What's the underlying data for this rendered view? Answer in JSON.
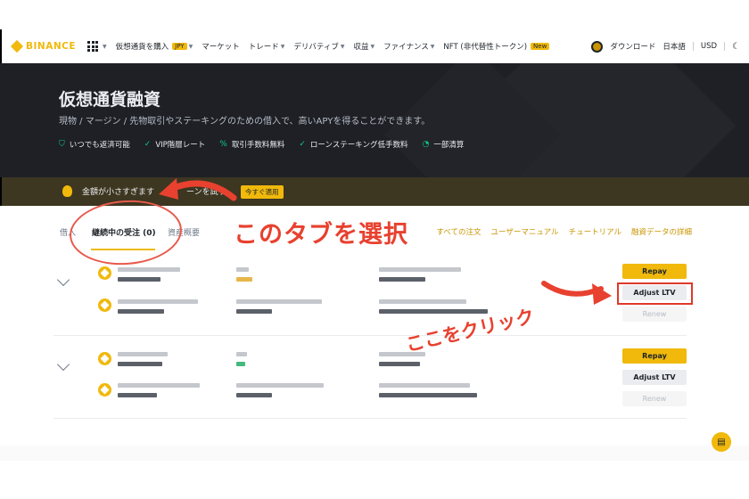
{
  "nav": {
    "logo": "BINANCE",
    "menu": [
      {
        "label": "仮想通貨を購入",
        "tag": "JPY"
      },
      {
        "label": "マーケット",
        "tag": ""
      },
      {
        "label": "トレード",
        "tag": ""
      },
      {
        "label": "デリバティブ",
        "tag": ""
      },
      {
        "label": "収益",
        "tag": ""
      },
      {
        "label": "ファイナンス",
        "tag": ""
      },
      {
        "label": "NFT (非代替性トークン)",
        "tag": "New"
      }
    ],
    "download": "ダウンロード",
    "language": "日本語",
    "currency": "USD",
    "theme_icon": "moon-icon"
  },
  "hero": {
    "title": "仮想通貨融資",
    "subtitle": "現物 / マージン / 先物取引やステーキングのための借入で、高いAPYを得ることができます。",
    "features": [
      {
        "icon": "shield-icon",
        "label": "いつでも返済可能"
      },
      {
        "icon": "check-icon",
        "label": "VIP階層レート"
      },
      {
        "icon": "percent-icon",
        "label": "取引手数料無料"
      },
      {
        "icon": "check-icon",
        "label": "ローンステーキング低手数料"
      },
      {
        "icon": "pie-icon",
        "label": "一部清算"
      }
    ]
  },
  "banner": {
    "text_start": "金額が小さすぎます",
    "text_end": "ーンを試す",
    "button": "今すぐ適用"
  },
  "tabs": {
    "borrow": "借入",
    "ongoing": "継続中の受注 (0)",
    "overview": "資産概要"
  },
  "links": [
    "すべての注文",
    "ユーザーマニュアル",
    "チュートリアル",
    "融資データの詳細"
  ],
  "rows": [
    {
      "buttons": {
        "repay": "Repay",
        "adjust": "Adjust LTV",
        "renew": "Renew"
      }
    },
    {
      "buttons": {
        "repay": "Repay",
        "adjust": "Adjust LTV",
        "renew": "Renew"
      }
    }
  ],
  "annotations": {
    "tab_hint": "このタブを選択",
    "click_hint": "ここをクリック"
  },
  "colors": {
    "brand": "#f0b90b",
    "hero_bg": "#1e2026",
    "annotation": "#e8412f"
  }
}
